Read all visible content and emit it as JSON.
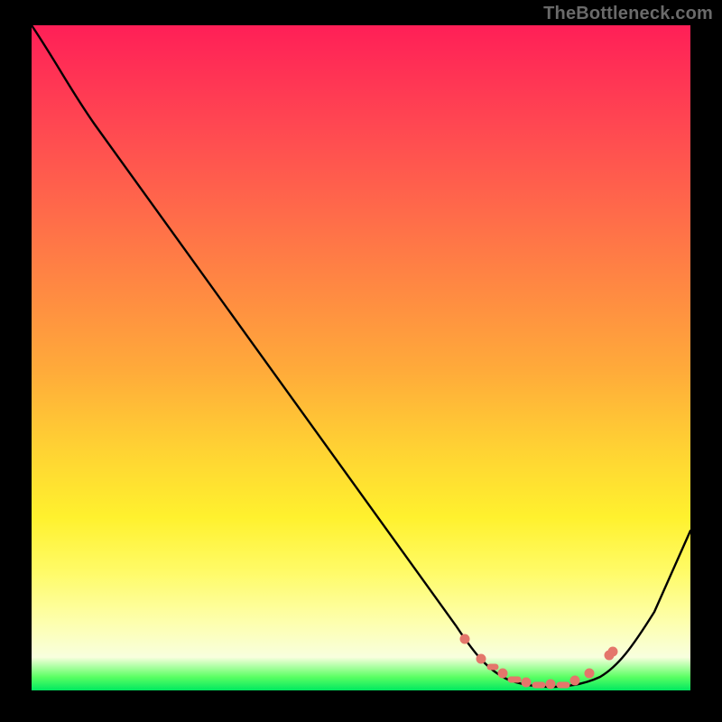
{
  "watermark": "TheBottleneck.com",
  "chart_data": {
    "type": "line",
    "title": "",
    "xlabel": "",
    "ylabel": "",
    "xlim": [
      0,
      100
    ],
    "ylim": [
      0,
      100
    ],
    "series": [
      {
        "name": "bottleneck-curve",
        "x": [
          0,
          6,
          20,
          40,
          60,
          66,
          70,
          74,
          78,
          82,
          86,
          90,
          100
        ],
        "y": [
          100,
          94,
          76,
          50,
          23,
          14,
          8,
          3,
          1,
          1,
          3,
          8,
          26
        ]
      }
    ],
    "markers": {
      "name": "optimal-range",
      "color": "#e4766b",
      "x": [
        66,
        68,
        70,
        72,
        74,
        76,
        78,
        80,
        82,
        84,
        86,
        88
      ],
      "y": [
        12,
        9,
        6,
        4,
        2.5,
        1.3,
        0.7,
        0.7,
        1.3,
        2.5,
        4.5,
        7.5
      ]
    },
    "gradient_stops": [
      {
        "pct": 0,
        "color": "#ff1f57"
      },
      {
        "pct": 16,
        "color": "#ff4a51"
      },
      {
        "pct": 40,
        "color": "#ff8a42"
      },
      {
        "pct": 64,
        "color": "#ffd333"
      },
      {
        "pct": 82,
        "color": "#fffb66"
      },
      {
        "pct": 95,
        "color": "#f8ffde"
      },
      {
        "pct": 100,
        "color": "#00e860"
      }
    ]
  }
}
